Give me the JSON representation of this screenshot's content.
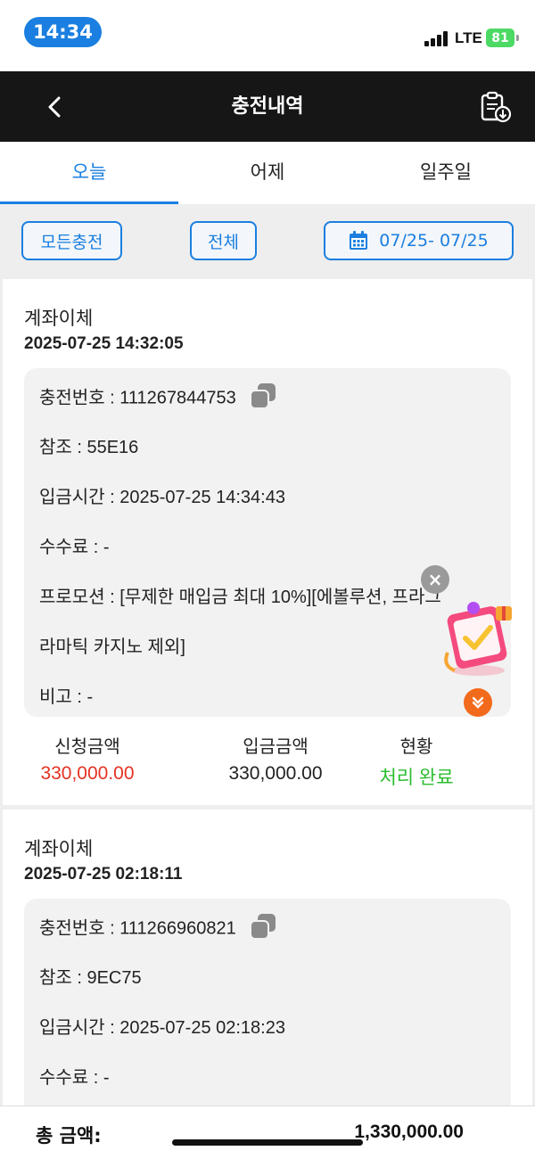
{
  "status_bar": {
    "time": "14:34",
    "network": "LTE",
    "battery": "81"
  },
  "header": {
    "title": "충전내역",
    "back_icon": "chevron-left-icon",
    "history_icon": "clipboard-download-icon"
  },
  "tabs": [
    {
      "label": "오늘",
      "active": true
    },
    {
      "label": "어제",
      "active": false
    },
    {
      "label": "일주일",
      "active": false
    }
  ],
  "filters": {
    "charge_type": "모든충전",
    "status": "전체",
    "date_range": "07/25- 07/25"
  },
  "records": [
    {
      "method": "계좌이체",
      "created_at": "2025-07-25 14:32:05",
      "details": {
        "charge_no": "충전번호 : 111267844753",
        "reference": "참조 : 55E16",
        "deposit_time": "입금시간 : 2025-07-25 14:34:43",
        "fee": "수수료 : -",
        "promotion_line1": "프로모션 : [무제한 매입금 최대 10%][에볼루션, 프라그",
        "promotion_line2": "라마틱 카지노 제외]",
        "note": "비고 : -"
      },
      "summary": {
        "requested_label": "신청금액",
        "requested": "330,000.00",
        "deposited_label": "입금금액",
        "deposited": "330,000.00",
        "status_label": "현황",
        "status": "처리 완료"
      }
    },
    {
      "method": "계좌이체",
      "created_at": "2025-07-25 02:18:11",
      "details": {
        "charge_no": "충전번호 : 111266960821",
        "reference": "참조 : 9EC75",
        "deposit_time": "입금시간 : 2025-07-25 02:18:23",
        "fee": "수수료 : -"
      }
    }
  ],
  "footer": {
    "total_label": "총 금액:",
    "total_value": "1,330,000.00"
  },
  "colors": {
    "accent": "#1a7fe0",
    "header_bg": "#161616",
    "amount_red": "#e53222",
    "status_green": "#2bbd2f"
  }
}
